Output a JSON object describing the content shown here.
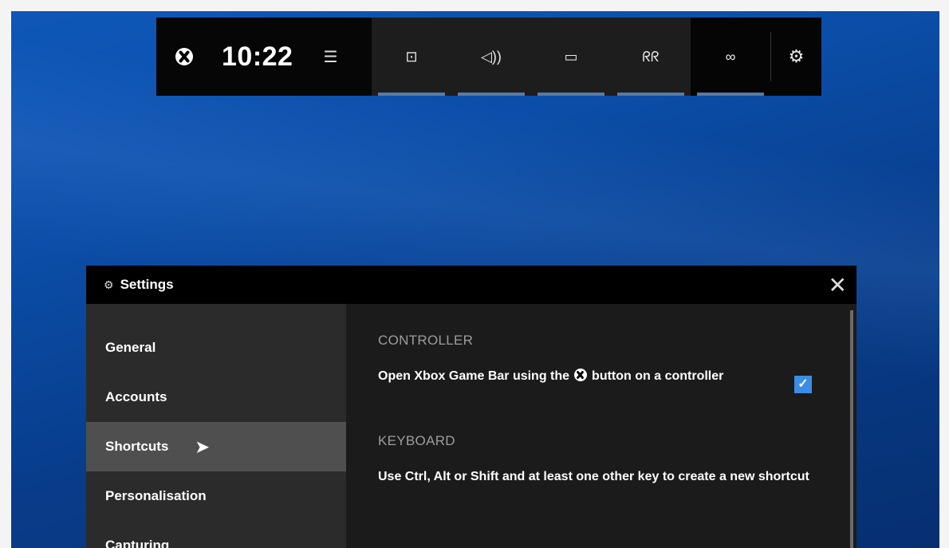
{
  "gamebar": {
    "clock": "10:22",
    "widgets": [
      {
        "icon": "capture-icon",
        "glyph": "⊡"
      },
      {
        "icon": "audio-icon",
        "glyph": "◁))"
      },
      {
        "icon": "performance-icon",
        "glyph": "▭"
      },
      {
        "icon": "social-icon",
        "glyph": "ᖇᖇ"
      }
    ],
    "right_widget": {
      "icon": "looking-for-group-icon",
      "glyph": "∞"
    },
    "settings_glyph": "⚙"
  },
  "settings": {
    "title": "Settings",
    "close_glyph": "✕",
    "nav": [
      {
        "label": "General"
      },
      {
        "label": "Accounts"
      },
      {
        "label": "Shortcuts",
        "active": true
      },
      {
        "label": "Personalisation"
      },
      {
        "label": "Capturing"
      }
    ],
    "content": {
      "controller_heading": "CONTROLLER",
      "controller_text_before": "Open Xbox Game Bar using the",
      "controller_text_after": "button on a controller",
      "controller_checked": true,
      "keyboard_heading": "KEYBOARD",
      "keyboard_text": "Use Ctrl, Alt or Shift and at least one other key to create a new shortcut"
    }
  }
}
